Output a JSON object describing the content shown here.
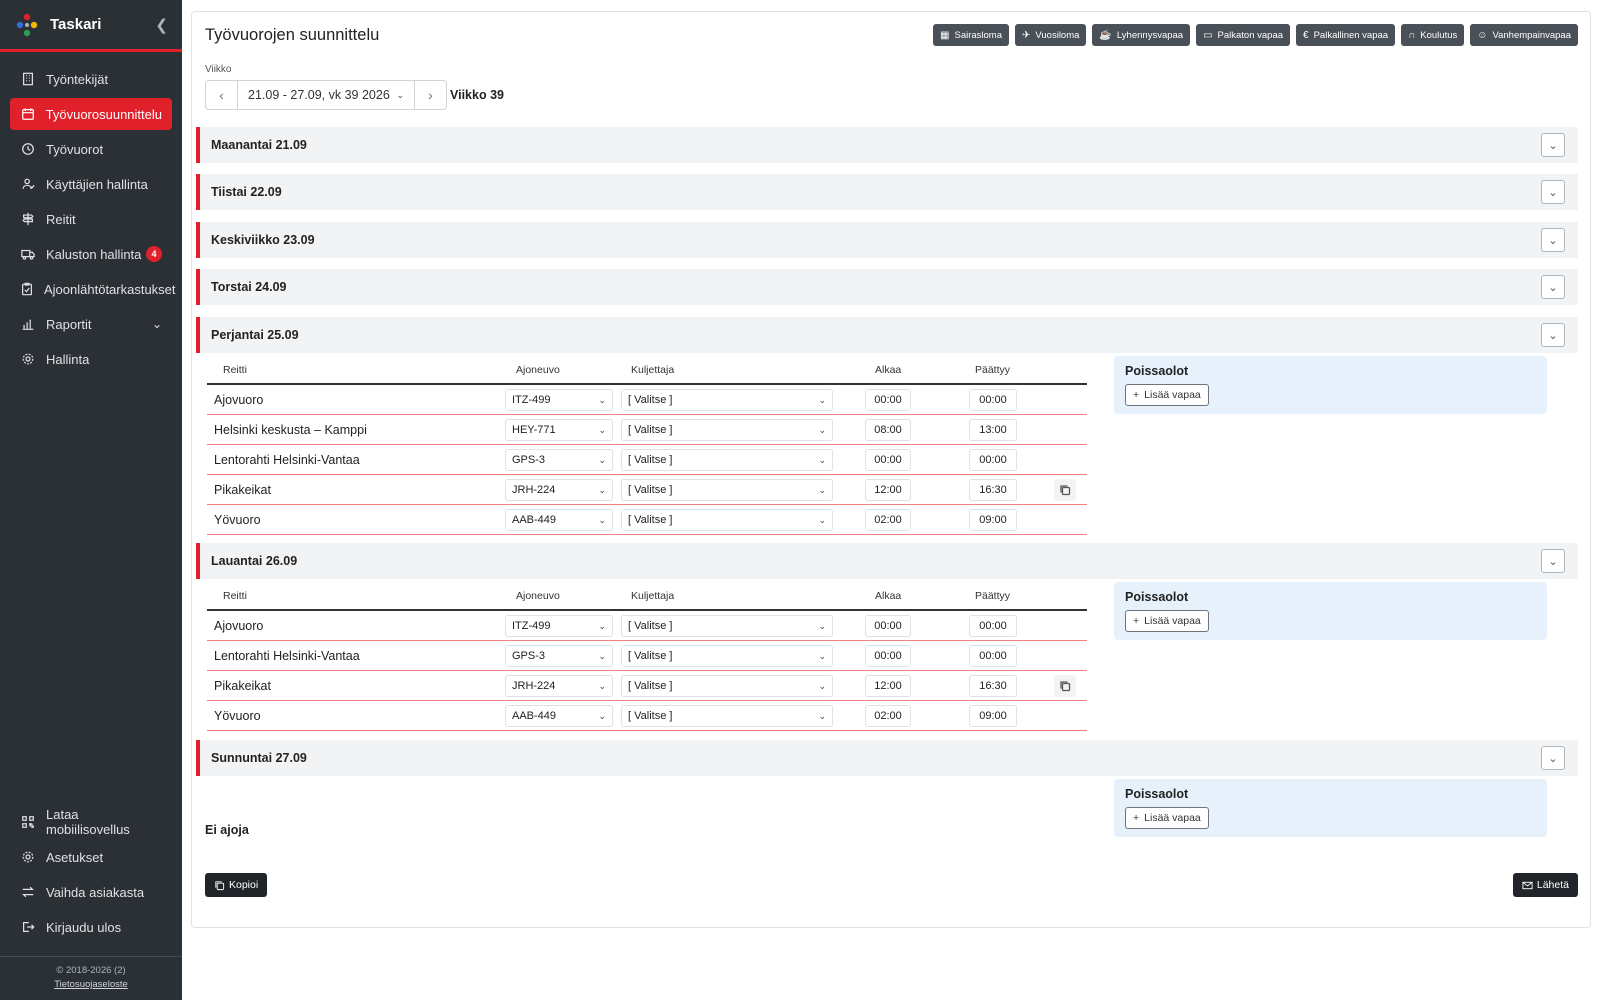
{
  "app": {
    "name": "Taskari"
  },
  "sidebar": {
    "items": [
      {
        "label": "Työntekijät",
        "icon": "building-icon"
      },
      {
        "label": "Työvuorosuunnittelu",
        "icon": "calendar-icon",
        "active": true
      },
      {
        "label": "Työvuorot",
        "icon": "clock-icon"
      },
      {
        "label": "Käyttäjien hallinta",
        "icon": "users-icon"
      },
      {
        "label": "Reitit",
        "icon": "signpost-icon"
      },
      {
        "label": "Kaluston hallinta",
        "icon": "truck-icon",
        "badge": "4"
      },
      {
        "label": "Ajoonlähtötarkastukset",
        "icon": "clipboard-check-icon"
      },
      {
        "label": "Raportit",
        "icon": "bar-chart-icon",
        "expandable": true
      },
      {
        "label": "Hallinta",
        "icon": "gear-icon"
      }
    ],
    "bottom_items": [
      {
        "label": "Lataa mobiilisovellus",
        "icon": "qr-code-icon"
      },
      {
        "label": "Asetukset",
        "icon": "gear-icon"
      },
      {
        "label": "Vaihda asiakasta",
        "icon": "swap-icon"
      },
      {
        "label": "Kirjaudu ulos",
        "icon": "logout-icon"
      }
    ],
    "footer": {
      "copyright": "© 2018-2026 (2)",
      "privacy_link": "Tietosuojaseloste"
    }
  },
  "page": {
    "title": "Työvuorojen suunnittelu",
    "absence_buttons": [
      {
        "label": "Sairasloma",
        "icon": "hospital-icon"
      },
      {
        "label": "Vuosiloma",
        "icon": "airplane-icon"
      },
      {
        "label": "Lyhennysvapaa",
        "icon": "cup-icon"
      },
      {
        "label": "Palkaton vapaa",
        "icon": "card-icon"
      },
      {
        "label": "Palkallinen vapaa",
        "icon": "euro-icon"
      },
      {
        "label": "Koulutus",
        "icon": "headset-icon"
      },
      {
        "label": "Vanhempainvapaa",
        "icon": "person-add-icon"
      }
    ],
    "week": {
      "label": "Viikko",
      "selected": "21.09 - 27.09, vk 39 2026",
      "week_text": "Viikko 39"
    },
    "days": [
      {
        "title": "Maanantai 21.09"
      },
      {
        "title": "Tiistai 22.09"
      },
      {
        "title": "Keskiviikko 23.09"
      },
      {
        "title": "Torstai 24.09"
      },
      {
        "title": "Perjantai 25.09"
      },
      {
        "title": "Lauantai 26.09"
      },
      {
        "title": "Sunnuntai 27.09"
      }
    ],
    "table_headers": {
      "route": "Reitti",
      "vehicle": "Ajoneuvo",
      "driver": "Kuljettaja",
      "start": "Alkaa",
      "end": "Päättyy"
    },
    "friday_rows": [
      {
        "route": "Ajovuoro",
        "vehicle": "ITZ-499",
        "driver": "[ Valitse ]",
        "start": "00:00",
        "end": "00:00",
        "copy": false
      },
      {
        "route": "Helsinki keskusta – Kamppi",
        "vehicle": "HEY-771",
        "driver": "[ Valitse ]",
        "start": "08:00",
        "end": "13:00",
        "copy": false
      },
      {
        "route": "Lentorahti Helsinki-Vantaa",
        "vehicle": "GPS-3",
        "driver": "[ Valitse ]",
        "start": "00:00",
        "end": "00:00",
        "copy": false
      },
      {
        "route": "Pikakeikat",
        "vehicle": "JRH-224",
        "driver": "[ Valitse ]",
        "start": "12:00",
        "end": "16:30",
        "copy": true
      },
      {
        "route": "Yövuoro",
        "vehicle": "AAB-449",
        "driver": "[ Valitse ]",
        "start": "02:00",
        "end": "09:00",
        "copy": false
      }
    ],
    "saturday_rows": [
      {
        "route": "Ajovuoro",
        "vehicle": "ITZ-499",
        "driver": "[ Valitse ]",
        "start": "00:00",
        "end": "00:00",
        "copy": false
      },
      {
        "route": "Lentorahti Helsinki-Vantaa",
        "vehicle": "GPS-3",
        "driver": "[ Valitse ]",
        "start": "00:00",
        "end": "00:00",
        "copy": false
      },
      {
        "route": "Pikakeikat",
        "vehicle": "JRH-224",
        "driver": "[ Valitse ]",
        "start": "12:00",
        "end": "16:30",
        "copy": true
      },
      {
        "route": "Yövuoro",
        "vehicle": "AAB-449",
        "driver": "[ Valitse ]",
        "start": "02:00",
        "end": "09:00",
        "copy": false
      }
    ],
    "absences": {
      "title": "Poissaolot",
      "add_label": "Lisää vapaa"
    },
    "sunday_empty": "Ei ajoja",
    "copy_button": "Kopioi",
    "send_button": "Lähetä"
  },
  "colors": {
    "accent": "#e0202a",
    "sidebar_bg": "#2b3035",
    "day_header_bg": "#f1f3f5",
    "absence_panel_bg": "#e7f1fb"
  }
}
